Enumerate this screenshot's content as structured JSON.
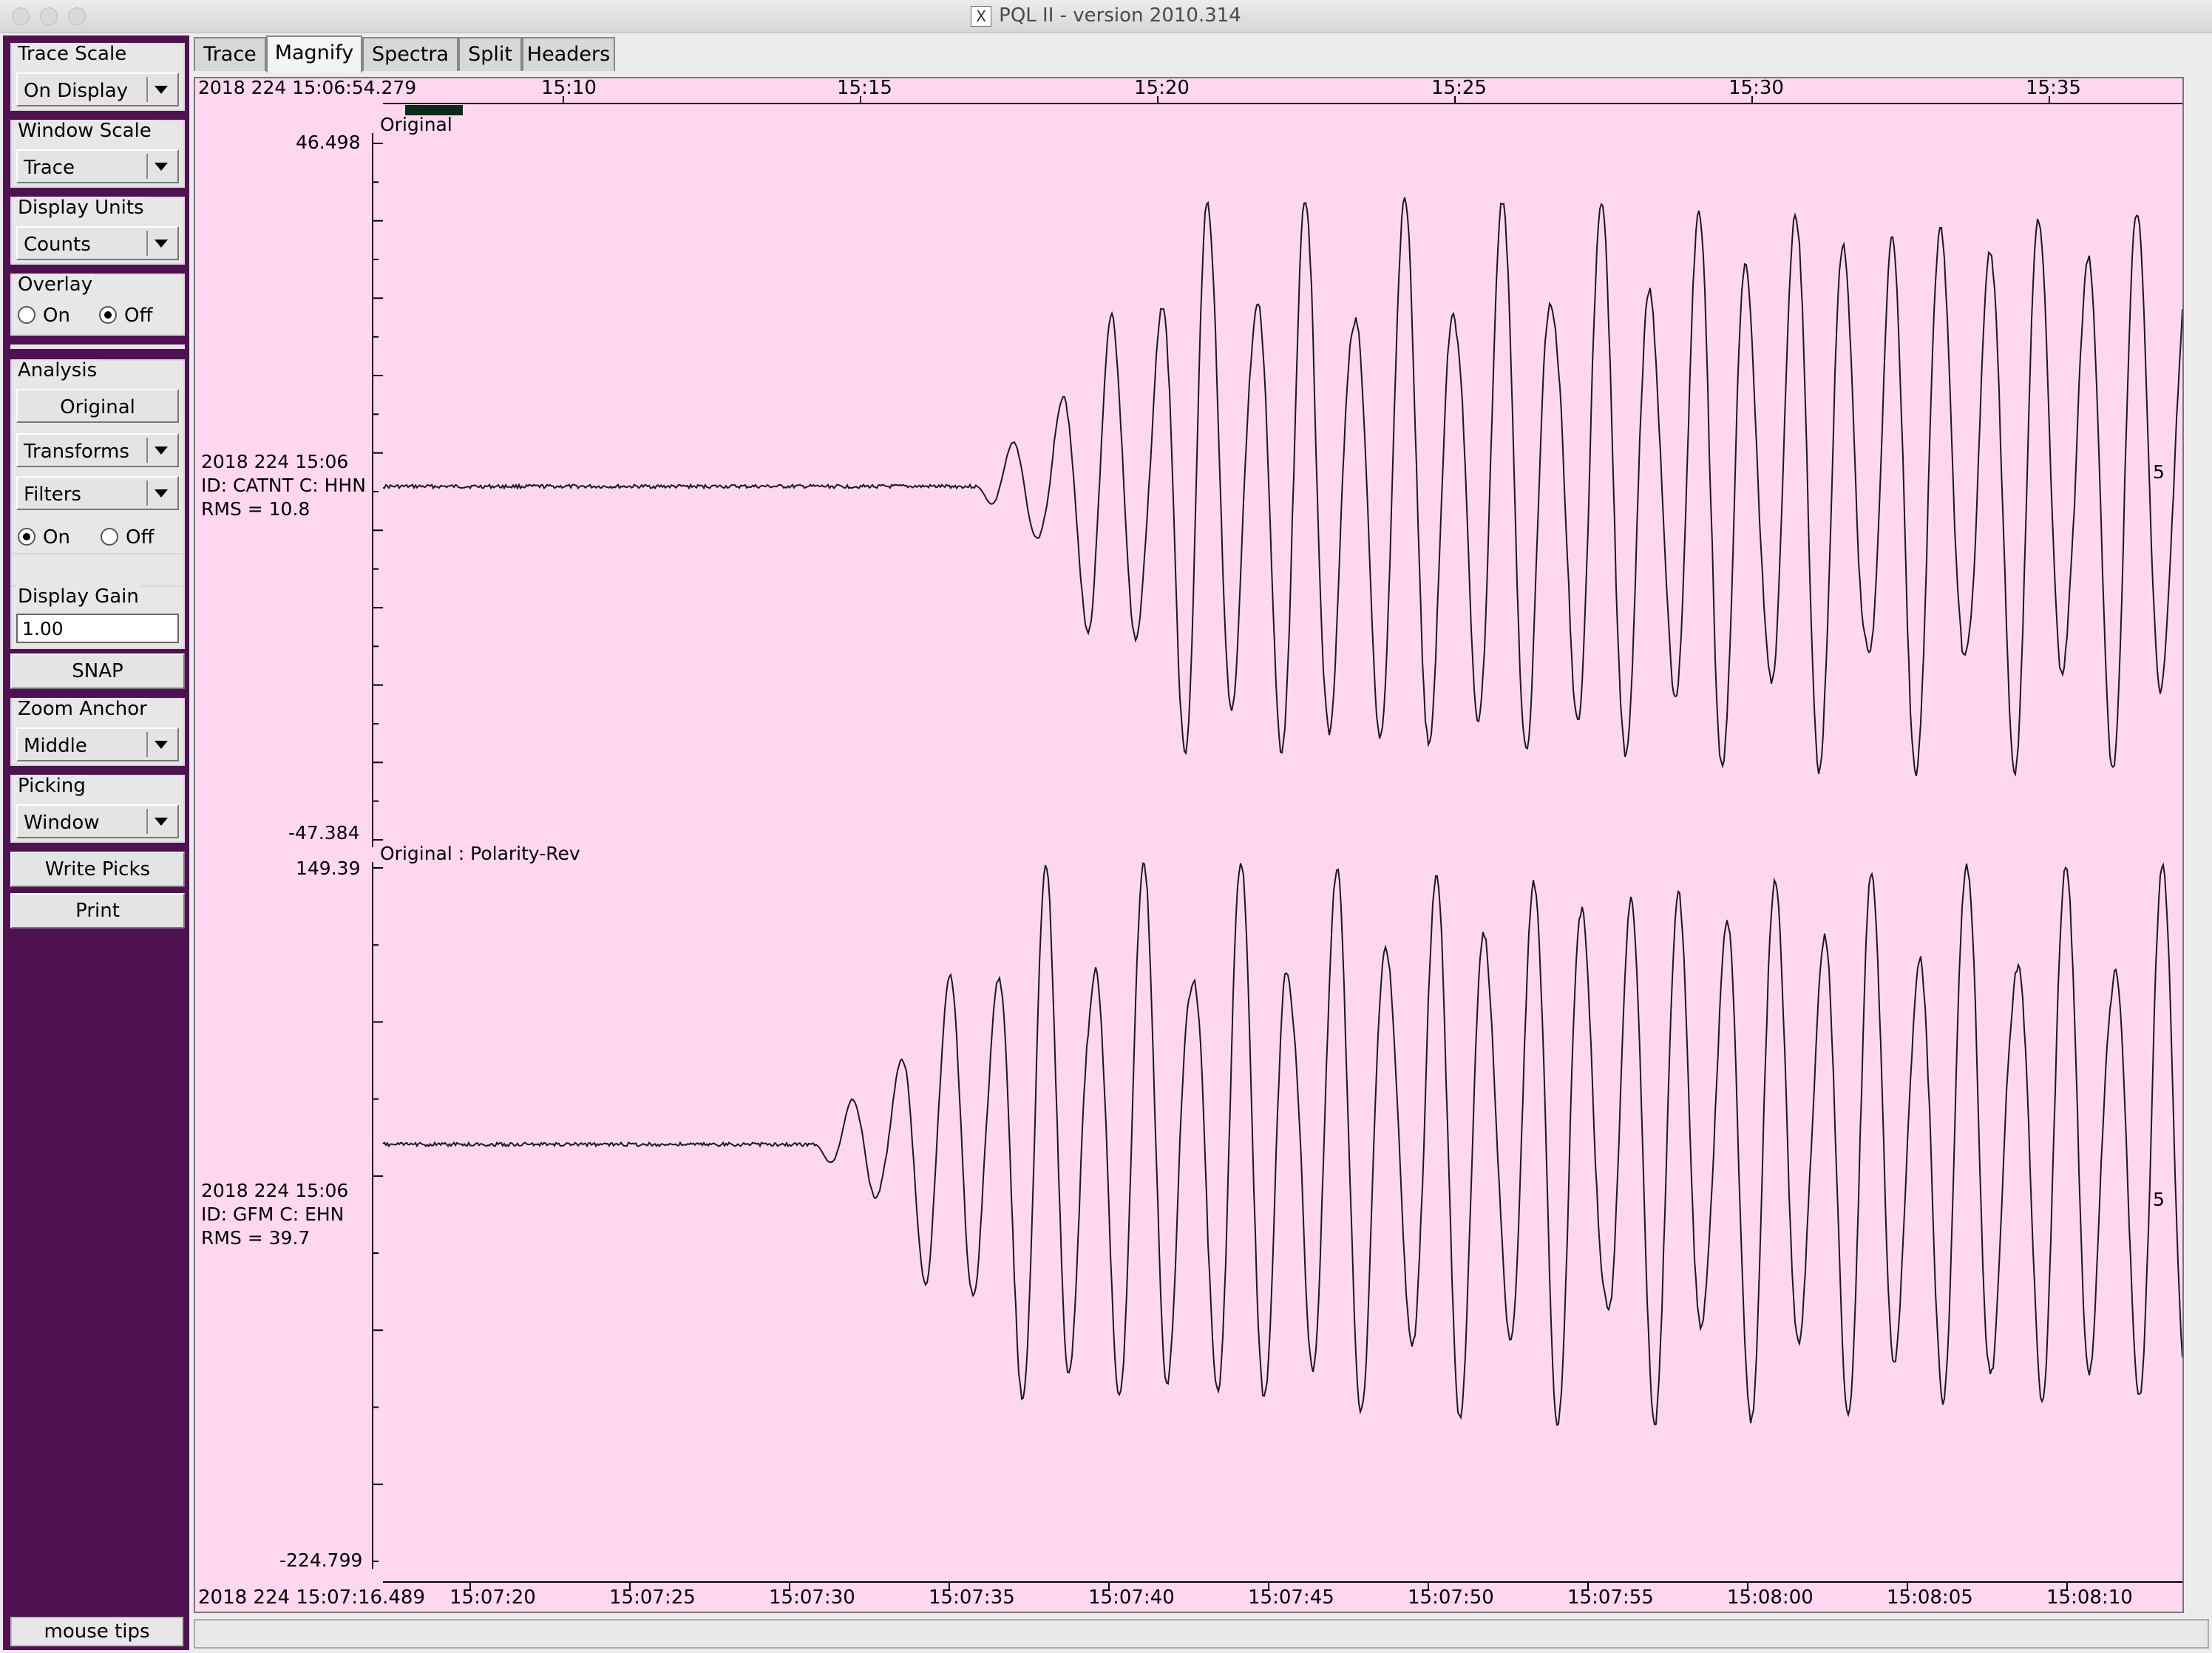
{
  "window": {
    "title": "PQL II - version 2010.314"
  },
  "controls": {
    "trace_scale": {
      "label": "Trace Scale",
      "value": "On Display"
    },
    "window_scale": {
      "label": "Window Scale",
      "value": "Trace"
    },
    "display_units": {
      "label": "Display Units",
      "value": "Counts"
    },
    "overlay": {
      "label": "Overlay",
      "on": "On",
      "off": "Off",
      "selected": "Off"
    },
    "analysis": {
      "label": "Analysis",
      "original": "Original",
      "transforms": "Transforms",
      "filters": "Filters",
      "on": "On",
      "off": "Off",
      "selected": "On"
    },
    "display_gain": {
      "label": "Display Gain",
      "value": "1.00"
    },
    "snap": "SNAP",
    "zoom_anchor": {
      "label": "Zoom Anchor",
      "value": "Middle"
    },
    "picking": {
      "label": "Picking",
      "value": "Window"
    },
    "write_picks": "Write Picks",
    "print": "Print",
    "mouse_tips": "mouse tips"
  },
  "tabs": [
    "Trace",
    "Magnify",
    "Spectra",
    "Split",
    "Headers"
  ],
  "active_tab": "Magnify",
  "top_axis": {
    "start_label": "2018 224 15:06:54.279",
    "ticks": [
      "15:10",
      "15:15",
      "15:20",
      "15:25",
      "15:30",
      "15:35"
    ]
  },
  "bottom_axis": {
    "start_label": "2018 224 15:07:16.489",
    "ticks": [
      "15:07:20",
      "15:07:25",
      "15:07:30",
      "15:07:35",
      "15:07:40",
      "15:07:45",
      "15:07:50",
      "15:07:55",
      "15:08:00",
      "15:08:05",
      "15:08:10"
    ]
  },
  "traces": [
    {
      "label": "Original",
      "ymax": "46.498",
      "ymin": "-47.384",
      "info_time": "2018 224 15:06",
      "info_id": "ID: CATNT C: HHN",
      "info_rms": "RMS = 10.8",
      "right_marker": "5"
    },
    {
      "label": "Original : Polarity-Rev",
      "ymax": "149.39",
      "ymin": "-224.799",
      "info_time": "2018 224 15:06",
      "info_id": "ID: GFM C: EHN",
      "info_rms": "RMS = 39.7",
      "right_marker": "5"
    }
  ],
  "colors": {
    "panel": "#4f1152",
    "plot_bg": "#ffd8f0",
    "trace": "#1a1a1a",
    "window_marker": "#0c2a1a"
  }
}
